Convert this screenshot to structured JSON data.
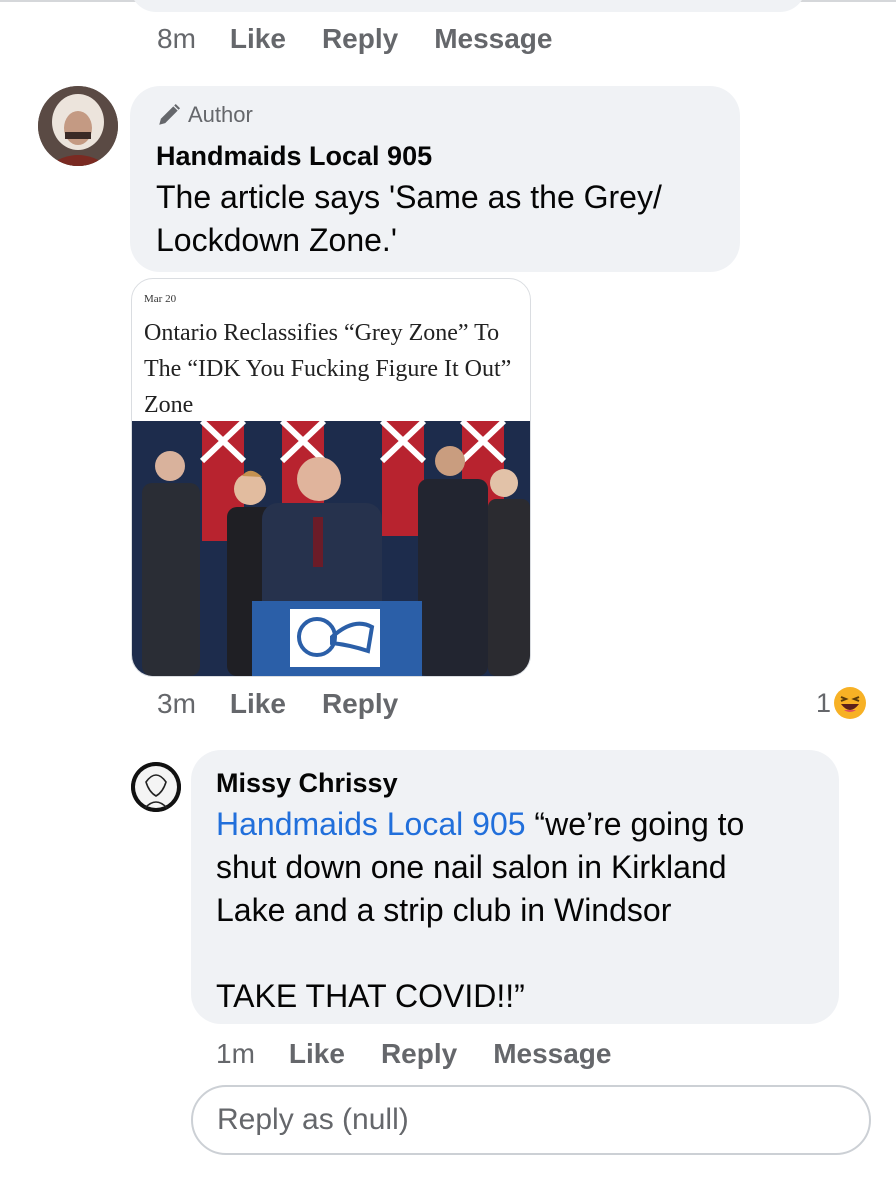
{
  "prev_comment": {
    "time": "8m",
    "like": "Like",
    "reply": "Reply",
    "message": "Message"
  },
  "comment1": {
    "badge": "Author",
    "name": "Handmaids Local 905",
    "text_line1": "The article says 'Same as the Grey/",
    "text_line2": "Lockdown Zone.'",
    "time": "3m",
    "like": "Like",
    "reply": "Reply",
    "reaction_count": "1",
    "reaction_icon": "laughing-emoji-icon"
  },
  "article_card": {
    "date": "Mar 20",
    "headline": "Ontario Reclassifies “Grey Zone” To The “IDK You Fucking Figure It Out” Zone"
  },
  "comment2": {
    "name": "Missy Chrissy",
    "mention": "Handmaids Local 905",
    "text_after_mention": " “we’re going to",
    "line2": "shut down one nail salon in Kirkland",
    "line3": "Lake and a strip club in Windsor",
    "line4": "TAKE THAT COVID!!”",
    "time": "1m",
    "like": "Like",
    "reply": "Reply",
    "message": "Message"
  },
  "reply_input": {
    "placeholder": "Reply as (null)"
  },
  "colors": {
    "bubble": "#f0f2f5",
    "secondary_text": "#65676b",
    "link": "#216fdb",
    "reaction_yellow": "#f7b125"
  }
}
